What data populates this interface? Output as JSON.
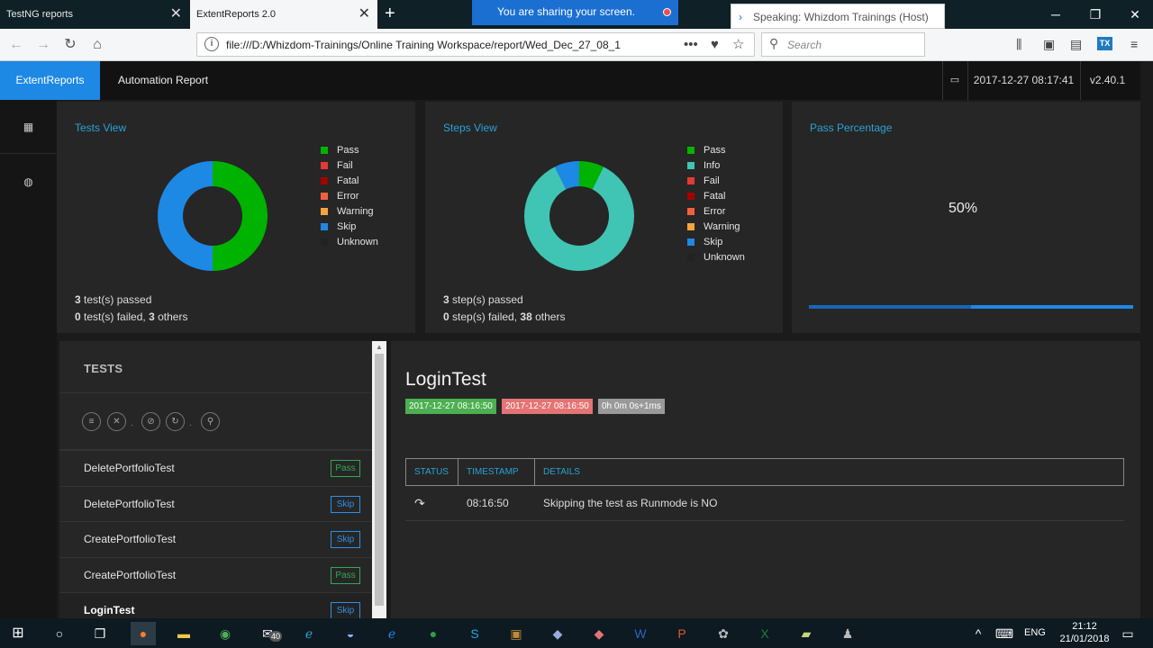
{
  "browser": {
    "tabs": [
      {
        "title": "TestNG reports",
        "active": false
      },
      {
        "title": "ExtentReports 2.0",
        "active": true
      }
    ],
    "sharing_banner": "You are sharing your screen.",
    "speaking_banner": "Speaking: Whizdom Trainings (Host)",
    "url": "file:///D:/Whizdom-Trainings/Online Training Workspace/report/Wed_Dec_27_08_1",
    "search_placeholder": "Search",
    "extension_label": "TX"
  },
  "header": {
    "brand": "ExtentReports",
    "title": "Automation Report",
    "datetime": "2017-12-27 08:17:41",
    "version": "v2.40.1"
  },
  "tests_view": {
    "title": "Tests View",
    "legend": [
      {
        "label": "Pass",
        "color": "#00b300"
      },
      {
        "label": "Fail",
        "color": "#e53935"
      },
      {
        "label": "Fatal",
        "color": "#a40000"
      },
      {
        "label": "Error",
        "color": "#f06040"
      },
      {
        "label": "Warning",
        "color": "#f5a340"
      },
      {
        "label": "Skip",
        "color": "#1e88e5"
      },
      {
        "label": "Unknown",
        "color": "#222222"
      }
    ],
    "passed_count": "3",
    "passed_text": "test(s) passed",
    "failed_count": "0",
    "failed_text": "test(s) failed,",
    "others_count": "3",
    "others_text": "others"
  },
  "steps_view": {
    "title": "Steps View",
    "legend": [
      {
        "label": "Pass",
        "color": "#00b300"
      },
      {
        "label": "Info",
        "color": "#40c4b4"
      },
      {
        "label": "Fail",
        "color": "#e53935"
      },
      {
        "label": "Fatal",
        "color": "#a40000"
      },
      {
        "label": "Error",
        "color": "#f06040"
      },
      {
        "label": "Warning",
        "color": "#f5a340"
      },
      {
        "label": "Skip",
        "color": "#1e88e5"
      },
      {
        "label": "Unknown",
        "color": "#222222"
      }
    ],
    "passed_count": "3",
    "passed_text": "step(s) passed",
    "failed_count": "0",
    "failed_text": "step(s) failed,",
    "others_count": "38",
    "others_text": "others"
  },
  "pass_percentage": {
    "title": "Pass Percentage",
    "value_text": "50%",
    "value": 0.5
  },
  "chart_data": [
    {
      "type": "pie",
      "values": [
        3,
        0,
        0,
        0,
        0,
        3,
        0
      ]
    },
    {
      "type": "pie",
      "values": [
        3,
        35,
        0,
        0,
        0,
        0,
        3,
        0
      ]
    }
  ],
  "tests_panel": {
    "heading": "TESTS",
    "tools": [
      "list-icon",
      "close-icon",
      "ban-icon",
      "refresh-icon",
      "search-icon"
    ],
    "rows": [
      {
        "name": "DeletePortfolioTest",
        "status": "Pass"
      },
      {
        "name": "DeletePortfolioTest",
        "status": "Skip"
      },
      {
        "name": "CreatePortfolioTest",
        "status": "Skip"
      },
      {
        "name": "CreatePortfolioTest",
        "status": "Pass"
      },
      {
        "name": "LoginTest",
        "status": "Skip"
      }
    ]
  },
  "detail": {
    "title": "LoginTest",
    "start": "2017-12-27 08:16:50",
    "end": "2017-12-27 08:16:50",
    "duration": "0h 0m 0s+1ms",
    "columns": [
      "STATUS",
      "TIMESTAMP",
      "DETAILS"
    ],
    "log": {
      "status_icon": "skip-arrow-icon",
      "timestamp": "08:16:50",
      "details": "Skipping the test as Runmode is NO"
    }
  },
  "taskbar": {
    "mail_badge": "40",
    "lang": "ENG",
    "time": "21:12",
    "date": "21/01/2018"
  }
}
